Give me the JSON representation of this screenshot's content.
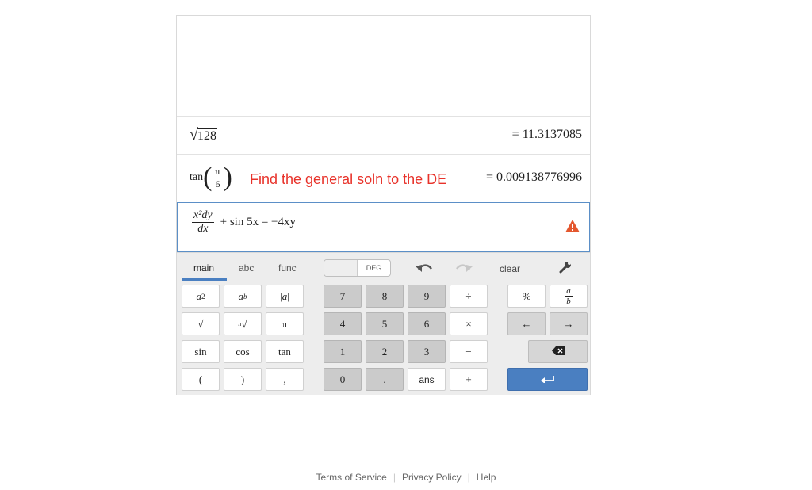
{
  "expressions": [
    {
      "expr_label": "√128",
      "radicand": "128",
      "result": "= 11.3137085"
    },
    {
      "expr_label": "tan(π/6)",
      "func": "tan",
      "num": "π",
      "den": "6",
      "note": "Find the general soln to the DE",
      "result": "= 0.009138776996"
    },
    {
      "expr_num": "x²dy",
      "expr_den": "dx",
      "expr_rest": "+ sin 5x = −4xy"
    }
  ],
  "keypad": {
    "tabs": [
      "main",
      "abc",
      "func"
    ],
    "deg_label": "DEG",
    "clear_label": "clear",
    "left_keys": [
      [
        "a²",
        "aᵇ",
        "|a|"
      ],
      [
        "√",
        "ⁿ√",
        "π"
      ],
      [
        "sin",
        "cos",
        "tan"
      ],
      [
        "(",
        ")",
        ","
      ]
    ],
    "num_keys": [
      [
        "7",
        "8",
        "9",
        "÷"
      ],
      [
        "4",
        "5",
        "6",
        "×"
      ],
      [
        "1",
        "2",
        "3",
        "−"
      ],
      [
        "0",
        ".",
        "ans",
        "+"
      ]
    ],
    "right_keys": [
      [
        "%",
        "a/b"
      ],
      [
        "←",
        "→"
      ]
    ],
    "backspace_icon": "backspace-icon",
    "enter_icon": "enter-icon",
    "accent_color": "#4a7fc1",
    "warning_color": "#e4572e"
  },
  "footer": {
    "terms": "Terms of Service",
    "privacy": "Privacy Policy",
    "help": "Help"
  }
}
